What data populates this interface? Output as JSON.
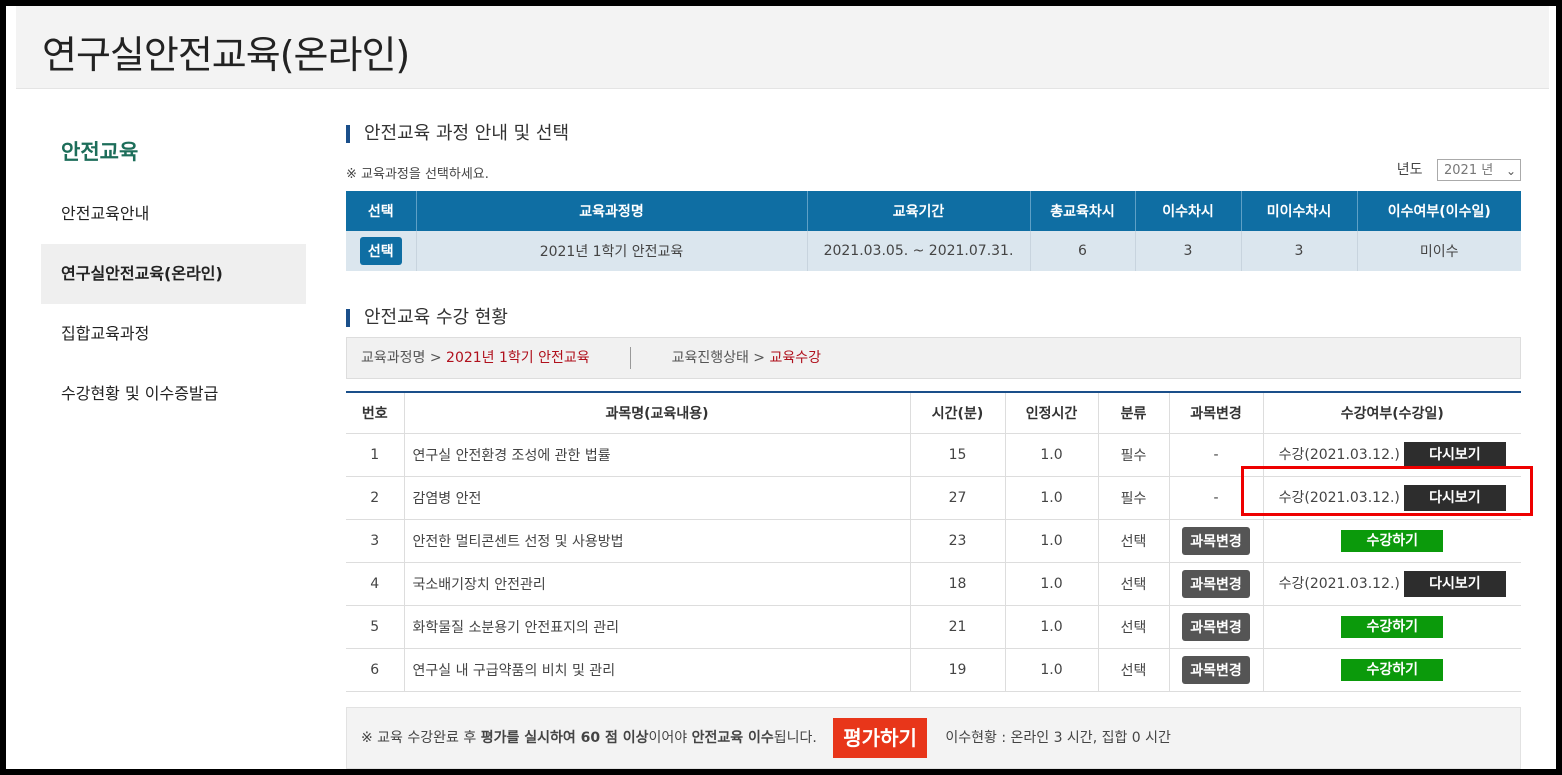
{
  "header": {
    "title": "연구실안전교육(온라인)"
  },
  "sidebar": {
    "title": "안전교육",
    "items": [
      {
        "label": "안전교육안내"
      },
      {
        "label": "연구실안전교육(온라인)"
      },
      {
        "label": "집합교육과정"
      },
      {
        "label": "수강현황 및 이수증발급"
      }
    ]
  },
  "course_section": {
    "title": "안전교육 과정 안내 및 선택",
    "notice": "※ 교육과정을 선택하세요.",
    "year_label": "년도",
    "year_value": "2021 년",
    "headers": [
      "선택",
      "교육과정명",
      "교육기간",
      "총교육차시",
      "이수차시",
      "미이수차시",
      "이수여부(이수일)"
    ],
    "row": {
      "select_label": "선택",
      "name": "2021년 1학기 안전교육",
      "period": "2021.03.05. ~ 2021.07.31.",
      "total": "6",
      "completed": "3",
      "incomplete": "3",
      "status": "미이수"
    }
  },
  "progress_section": {
    "title": "안전교육 수강 현황",
    "course_label": "교육과정명 >",
    "course_value": "2021년 1학기 안전교육",
    "state_label": "교육진행상태 >",
    "state_value": "교육수강",
    "headers": [
      "번호",
      "과목명(교육내용)",
      "시간(분)",
      "인정시간",
      "분류",
      "과목변경",
      "수강여부(수강일)"
    ],
    "rows": [
      {
        "no": "1",
        "name": "연구실 안전환경 조성에 관한 법률",
        "minutes": "15",
        "credit": "1.0",
        "type": "필수",
        "change": "-",
        "status": "수강(2021.03.12.)",
        "action": "다시보기"
      },
      {
        "no": "2",
        "name": "감염병 안전",
        "minutes": "27",
        "credit": "1.0",
        "type": "필수",
        "change": "-",
        "status": "수강(2021.03.12.)",
        "action": "다시보기"
      },
      {
        "no": "3",
        "name": "안전한 멀티콘센트 선정 및 사용방법",
        "minutes": "23",
        "credit": "1.0",
        "type": "선택",
        "change": "과목변경",
        "status": "",
        "action": "수강하기"
      },
      {
        "no": "4",
        "name": "국소배기장치 안전관리",
        "minutes": "18",
        "credit": "1.0",
        "type": "선택",
        "change": "과목변경",
        "status": "수강(2021.03.12.)",
        "action": "다시보기"
      },
      {
        "no": "5",
        "name": "화학물질 소분용기 안전표지의 관리",
        "minutes": "21",
        "credit": "1.0",
        "type": "선택",
        "change": "과목변경",
        "status": "",
        "action": "수강하기"
      },
      {
        "no": "6",
        "name": "연구실 내 구급약품의 비치 및 관리",
        "minutes": "19",
        "credit": "1.0",
        "type": "선택",
        "change": "과목변경",
        "status": "",
        "action": "수강하기"
      }
    ]
  },
  "footer": {
    "text_prefix": "※ 교육 수강완료 후 ",
    "text_bold1": "평가를 실시하여 60 점 이상",
    "text_mid": "이어야 ",
    "text_bold2": "안전교육 이수",
    "text_suffix": "됩니다.",
    "eval_button": "평가하기",
    "summary": "이수현황 : 온라인 3 시간, 집합 0 시간"
  }
}
